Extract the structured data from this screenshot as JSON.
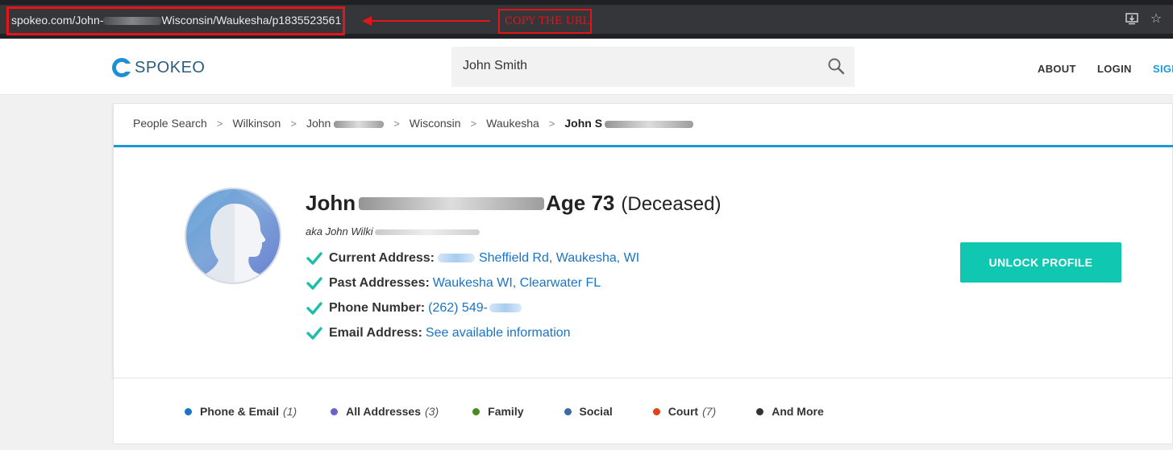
{
  "browser": {
    "url_prefix": "spokeo.com/John-",
    "url_suffix": "Wisconsin/Waukesha/p1835523561",
    "annotation": "COPY THE URL",
    "icons": [
      "install-icon",
      "star-icon"
    ]
  },
  "header": {
    "logo": "SPOKEO",
    "search_value": "John Smith",
    "nav": {
      "about": "ABOUT",
      "login": "LOGIN",
      "signup": "SIGN"
    }
  },
  "breadcrumb": {
    "items": [
      "People Search",
      "Wilkinson",
      "John",
      "Wisconsin",
      "Waukesha"
    ],
    "current": "John S"
  },
  "profile": {
    "first_name": "John",
    "age": "Age 73",
    "status": "(Deceased)",
    "aka": "aka John Wilki",
    "facts": [
      {
        "label": "Current Address:",
        "value": "Sheffield Rd, Waukesha, WI"
      },
      {
        "label": "Past Addresses:",
        "value": "Waukesha WI, Clearwater FL"
      },
      {
        "label": "Phone Number:",
        "value": "(262) 549-"
      },
      {
        "label": "Email Address:",
        "value": "See available information"
      }
    ],
    "unlock_label": "UNLOCK PROFILE"
  },
  "tabs": [
    {
      "label": "Phone & Email",
      "count": "(1)",
      "color": "#1a73c4"
    },
    {
      "label": "All Addresses",
      "count": "(3)",
      "color": "#6b63c9"
    },
    {
      "label": "Family",
      "count": "",
      "color": "#4a8a1f"
    },
    {
      "label": "Social",
      "count": "",
      "color": "#3b6aa8"
    },
    {
      "label": "Court",
      "count": "(7)",
      "color": "#e0421a"
    },
    {
      "label": "And More",
      "count": "",
      "color": "#333333"
    }
  ],
  "colors": {
    "accent": "#10c7b2",
    "link": "#1a73c4",
    "annotation": "#e3141a",
    "rule": "#1b9ad6"
  }
}
